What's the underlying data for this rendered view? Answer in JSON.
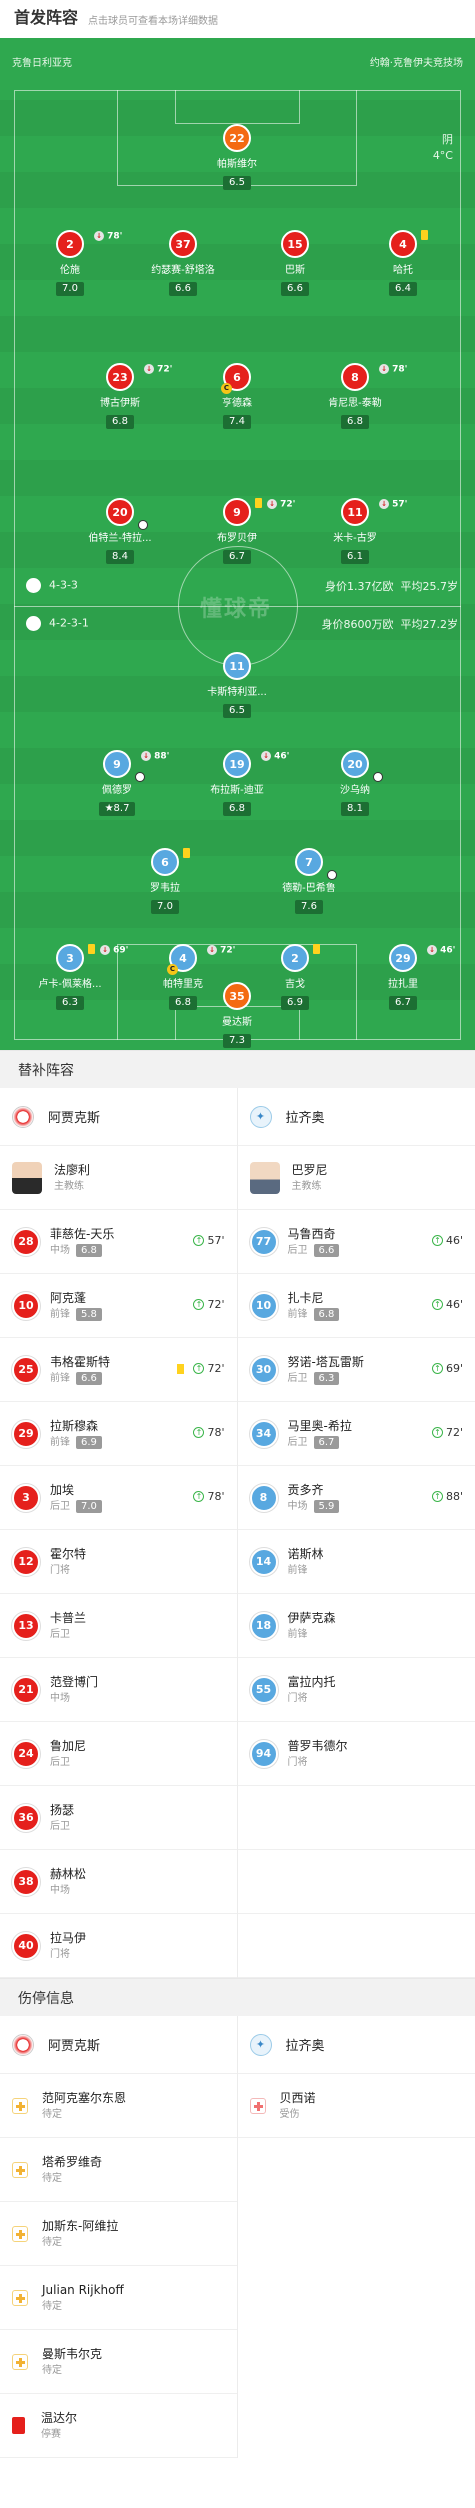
{
  "header": {
    "title": "首发阵容",
    "subtitle": "点击球员可查看本场详细数据"
  },
  "venue": {
    "home": "克鲁日利亚克",
    "away": "约翰·克鲁伊夫竞技场"
  },
  "weather": {
    "condition": "阴",
    "temp": "4°C"
  },
  "home_players": [
    {
      "num": "22",
      "name": "帕斯维尔",
      "rating": "6.5"
    },
    {
      "num": "2",
      "name": "伦施",
      "rating": "7.0",
      "sub": "78'"
    },
    {
      "num": "37",
      "name": "约瑟赛-舒塔洛",
      "rating": "6.6"
    },
    {
      "num": "15",
      "name": "巴斯",
      "rating": "6.6"
    },
    {
      "num": "4",
      "name": "哈托",
      "rating": "6.4"
    },
    {
      "num": "23",
      "name": "博古伊斯",
      "rating": "6.8",
      "sub": "72'"
    },
    {
      "num": "6",
      "name": "亨德森",
      "rating": "7.4"
    },
    {
      "num": "8",
      "name": "肯尼思-泰勒",
      "rating": "6.8",
      "sub": "78'"
    },
    {
      "num": "20",
      "name": "伯特兰-特拉...",
      "rating": "8.4"
    },
    {
      "num": "9",
      "name": "布罗贝伊",
      "rating": "6.7",
      "sub": "72'"
    },
    {
      "num": "11",
      "name": "米卡-古罗",
      "rating": "6.1",
      "sub": "57'"
    }
  ],
  "away_players": [
    {
      "num": "11",
      "name": "卡斯特利亚...",
      "rating": "6.5"
    },
    {
      "num": "9",
      "name": "佩德罗",
      "rating": "8.7",
      "sub": "88'"
    },
    {
      "num": "19",
      "name": "布拉斯-迪亚",
      "rating": "6.8",
      "sub": "46'"
    },
    {
      "num": "20",
      "name": "沙乌纳",
      "rating": "8.1"
    },
    {
      "num": "6",
      "name": "罗韦拉",
      "rating": "7.0"
    },
    {
      "num": "7",
      "name": "德勒-巴希鲁",
      "rating": "7.6"
    },
    {
      "num": "3",
      "name": "卢卡-佩莱格...",
      "rating": "6.3",
      "sub": "69'"
    },
    {
      "num": "4",
      "name": "帕特里克",
      "rating": "6.8",
      "sub": "72'"
    },
    {
      "num": "2",
      "name": "吉戈",
      "rating": "6.9"
    },
    {
      "num": "29",
      "name": "拉扎里",
      "rating": "6.7",
      "sub": "46'"
    },
    {
      "num": "35",
      "name": "曼达斯",
      "rating": "7.3"
    }
  ],
  "formation": {
    "home": {
      "shape": "4-3-3",
      "value": "身价1.37亿欧",
      "age": "平均25.7岁"
    },
    "away": {
      "shape": "4-2-3-1",
      "value": "身价8600万欧",
      "age": "平均27.2岁"
    }
  },
  "watermark": "懂球帝",
  "subs_section": {
    "title": "替补阵容",
    "home_team": "阿贾克斯",
    "away_team": "拉齐奥",
    "home_coach": {
      "name": "法廖利",
      "role": "主教练"
    },
    "away_coach": {
      "name": "巴罗尼",
      "role": "主教练"
    },
    "home": [
      {
        "num": "28",
        "name": "菲慈佐-天乐",
        "pos": "中场",
        "rating": "6.8",
        "min": "57'"
      },
      {
        "num": "10",
        "name": "阿克蓬",
        "pos": "前锋",
        "rating": "5.8",
        "min": "72'"
      },
      {
        "num": "25",
        "name": "韦格霍斯特",
        "pos": "前锋",
        "rating": "6.6",
        "min": "72'"
      },
      {
        "num": "29",
        "name": "拉斯穆森",
        "pos": "前锋",
        "rating": "6.9",
        "min": "78'"
      },
      {
        "num": "3",
        "name": "加埃",
        "pos": "后卫",
        "rating": "7.0",
        "min": "78'"
      },
      {
        "num": "12",
        "name": "霍尔特",
        "pos": "门将"
      },
      {
        "num": "13",
        "name": "卡普兰",
        "pos": "后卫"
      },
      {
        "num": "21",
        "name": "范登博门",
        "pos": "中场"
      },
      {
        "num": "24",
        "name": "鲁加尼",
        "pos": "后卫"
      },
      {
        "num": "36",
        "name": "扬瑟",
        "pos": "后卫"
      },
      {
        "num": "38",
        "name": "赫林松",
        "pos": "中场"
      },
      {
        "num": "40",
        "name": "拉马伊",
        "pos": "门将"
      }
    ],
    "away": [
      {
        "num": "77",
        "name": "马鲁西奇",
        "pos": "后卫",
        "rating": "6.6",
        "min": "46'"
      },
      {
        "num": "10",
        "name": "扎卡尼",
        "pos": "前锋",
        "rating": "6.8",
        "min": "46'"
      },
      {
        "num": "30",
        "name": "努诺-塔瓦雷斯",
        "pos": "后卫",
        "rating": "6.3",
        "min": "69'"
      },
      {
        "num": "34",
        "name": "马里奥-希拉",
        "pos": "后卫",
        "rating": "6.7",
        "min": "72'"
      },
      {
        "num": "8",
        "name": "贡多齐",
        "pos": "中场",
        "rating": "5.9",
        "min": "88'"
      },
      {
        "num": "14",
        "name": "诺斯林",
        "pos": "前锋"
      },
      {
        "num": "18",
        "name": "伊萨克森",
        "pos": "前锋"
      },
      {
        "num": "55",
        "name": "富拉内托",
        "pos": "门将"
      },
      {
        "num": "94",
        "name": "普罗韦德尔",
        "pos": "门将"
      }
    ]
  },
  "injury_section": {
    "title": "伤停信息",
    "home_team": "阿贾克斯",
    "away_team": "拉齐奥",
    "home": [
      {
        "name": "范阿克塞尔东恩",
        "status": "待定"
      },
      {
        "name": "塔希罗维奇",
        "status": "待定"
      },
      {
        "name": "加斯东-阿维拉",
        "status": "待定"
      },
      {
        "name": "Julian Rijkhoff",
        "status": "待定"
      },
      {
        "name": "曼斯韦尔克",
        "status": "待定"
      },
      {
        "name": "温达尔",
        "status": "停赛"
      }
    ],
    "away": [
      {
        "name": "贝西诺",
        "status": "受伤"
      }
    ]
  }
}
